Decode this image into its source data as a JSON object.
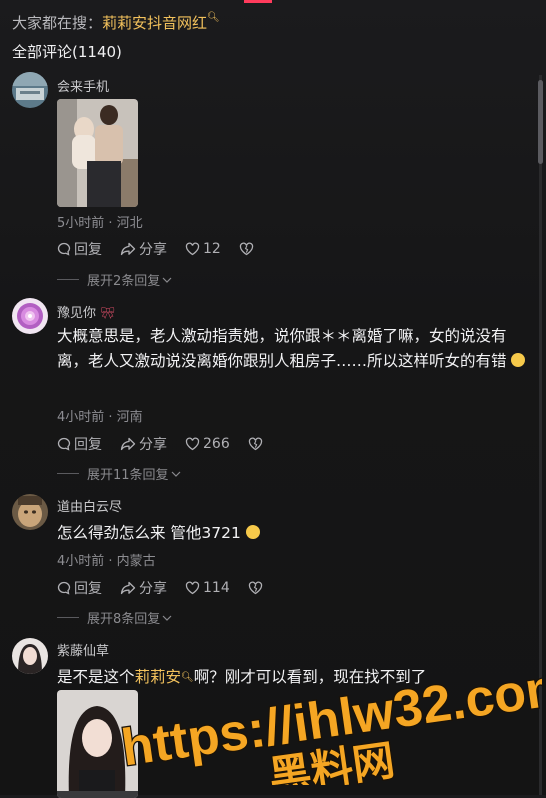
{
  "header": {
    "search_prefix": "大家都在搜：",
    "search_keyword": "莉莉安抖音网红",
    "total_label": "全部评论(1140)"
  },
  "comments": [
    {
      "username": "会来手机",
      "time_location": "5小时前 · 河北",
      "reply_label": "回复",
      "share_label": "分享",
      "likes": "12",
      "expand_label": "展开2条回复"
    },
    {
      "username": "豫见你",
      "text": "大概意思是，老人激动指责她，说你跟＊＊离婚了嘛，女的说没有离，老人又激动说没离婚你跟别人租房子……所以这样听女的有错",
      "time_location": "4小时前 · 河南",
      "reply_label": "回复",
      "share_label": "分享",
      "likes": "266",
      "expand_label": "展开11条回复"
    },
    {
      "username": "道由白云尽",
      "text": "怎么得劲怎么来 管他3721",
      "time_location": "4小时前 · 内蒙古",
      "reply_label": "回复",
      "share_label": "分享",
      "likes": "114",
      "expand_label": "展开8条回复"
    },
    {
      "username": "紫藤仙草",
      "text_prefix": "是不是这个",
      "text_keyword": "莉莉安",
      "text_suffix": "啊？刚才可以看到，现在找不到了"
    }
  ],
  "watermark": {
    "line1": "https://ihlw32.com",
    "line2": "黑料网"
  },
  "colors": {
    "keyword": "#f2c15c",
    "accent_red": "#ff3b5c",
    "watermark": "#f5a623"
  }
}
